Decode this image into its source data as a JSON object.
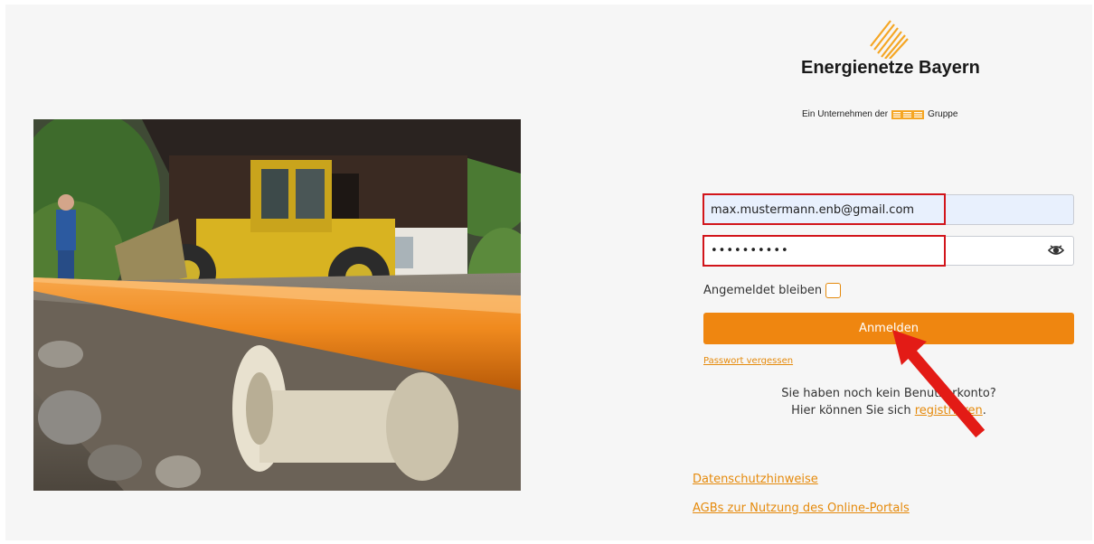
{
  "brand": {
    "name": "Energienetze Bayern",
    "tagline_prefix": "Ein Unternehmen der",
    "tagline_group": "ESB",
    "tagline_suffix": "Gruppe"
  },
  "login": {
    "email_value": "max.mustermann.enb@gmail.com",
    "password_value": "••••••••••",
    "remember_label": "Angemeldet bleiben",
    "submit_label": "Anmelden",
    "forgot_label": "Passwort vergessen",
    "no_account_text": "Sie haben noch kein Benutzerkonto?",
    "register_prefix": "Hier können Sie sich",
    "register_link": "registrieren",
    "register_suffix": "."
  },
  "footer": {
    "privacy_link": "Datenschutzhinweise",
    "agb_link": "AGBs zur Nutzung des Online-Portals"
  },
  "icons": {
    "eye": "eye-icon",
    "logo": "logo-icon"
  },
  "colors": {
    "accent": "#ef8610",
    "highlight": "#d2151b",
    "autofill_bg": "#e8f0fd"
  }
}
